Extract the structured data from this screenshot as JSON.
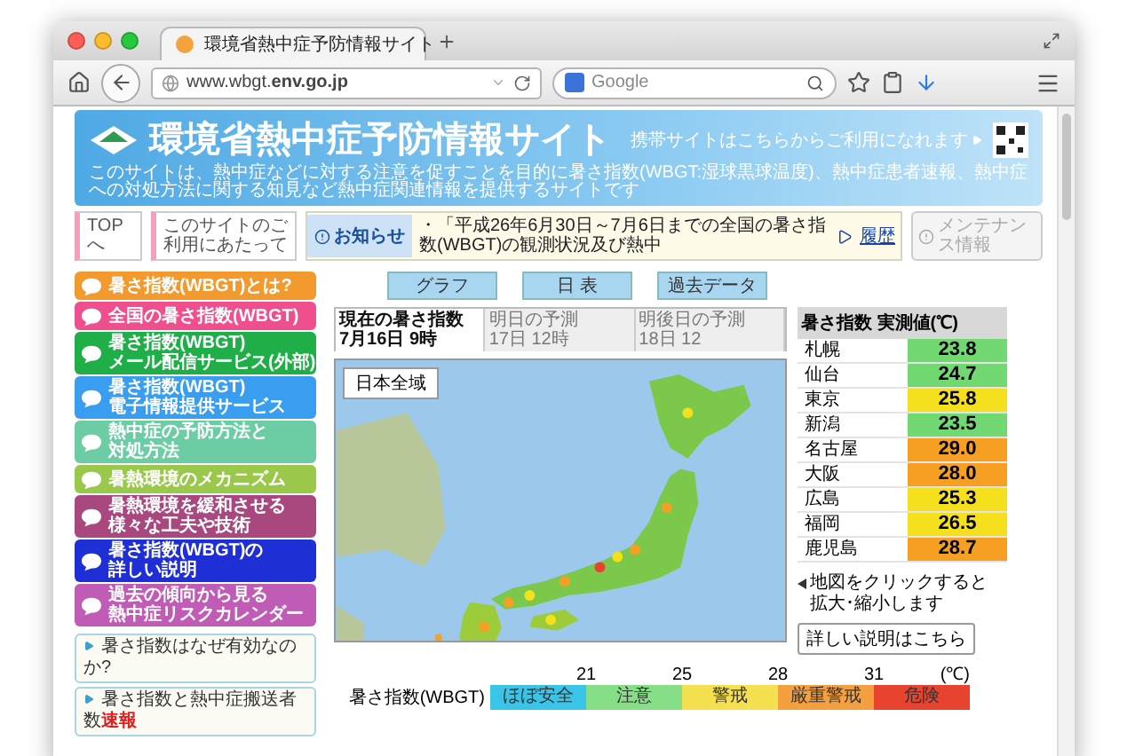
{
  "browser": {
    "tab_title": "環境省熱中症予防情報サイト",
    "url": "www.wbgt.**env.go.jp**",
    "search_placeholder": "Google"
  },
  "header": {
    "title": "環境省熱中症予防情報サイト",
    "mobile_note": "携帯サイトはこちらからご利用になれます",
    "tagline": "このサイトは、熱中症などに対する注意を促すことを目的に暑さ指数(WBGT:湿球黒球温度)、熱中症患者速報、熱中症への対処方法に関する知見など熱中症関連情報を提供するサイトです"
  },
  "nav": {
    "top": "TOPへ",
    "about": "このサイトのご利用にあたって",
    "notice_label": "お知らせ",
    "notice_text": "・「平成26年6月30日～7月6日までの全国の暑さ指数(WBGT)の観測状況及び熱中",
    "history": "履歴",
    "maintenance": {
      "label": "メンテナンス情報",
      "disabled": true
    }
  },
  "sidebar": {
    "items": [
      {
        "lines": [
          "暑さ指数(WBGT)とは?"
        ],
        "color": "#f39a2e"
      },
      {
        "lines": [
          "全国の暑さ指数(WBGT)"
        ],
        "color": "#ef4f8c"
      },
      {
        "lines": [
          "暑さ指数(WBGT)",
          "メール配信サービス(外部)"
        ],
        "color": "#1fae48"
      },
      {
        "lines": [
          "暑さ指数(WBGT)",
          "電子情報提供サービス"
        ],
        "color": "#3a9ef0"
      },
      {
        "lines": [
          "熱中症の予防方法と",
          "対処方法"
        ],
        "color": "#6ccca4"
      },
      {
        "lines": [
          "暑熱環境のメカニズム"
        ],
        "color": "#9ac84a"
      },
      {
        "lines": [
          "暑熱環境を緩和させる",
          "様々な工夫や技術"
        ],
        "color": "#a8487e"
      },
      {
        "lines": [
          "暑さ指数(WBGT)の",
          "詳しい説明"
        ],
        "color": "#1f2fd6"
      },
      {
        "lines": [
          "過去の傾向から見る",
          "熱中症リスクカレンダー"
        ],
        "color": "#c05cb6"
      }
    ],
    "links": [
      {
        "text": "暑さ指数はなぜ有効なのか?"
      },
      {
        "text": "暑さ指数と熱中症搬送者数",
        "badge": "速報"
      }
    ]
  },
  "views": [
    "グラフ",
    "日 表",
    "過去データ"
  ],
  "map": {
    "tabs": [
      {
        "label": "現在の暑さ指数",
        "time": "7月16日 9時",
        "selected": true
      },
      {
        "label": "明日の予測",
        "time": "17日 12時",
        "selected": false
      },
      {
        "label": "明後日の予測",
        "time": "18日 12",
        "selected": false
      }
    ],
    "region": "日本全域"
  },
  "readings": {
    "title": "暑さ指数 実測値(℃)",
    "rows": [
      {
        "city": "札幌",
        "value": "23.8",
        "color": "#72d872"
      },
      {
        "city": "仙台",
        "value": "24.7",
        "color": "#72d872"
      },
      {
        "city": "東京",
        "value": "25.8",
        "color": "#f5e01e"
      },
      {
        "city": "新潟",
        "value": "23.5",
        "color": "#72d872"
      },
      {
        "city": "名古屋",
        "value": "29.0",
        "color": "#f5a023"
      },
      {
        "city": "大阪",
        "value": "28.0",
        "color": "#f5a023"
      },
      {
        "city": "広島",
        "value": "25.3",
        "color": "#f5e01e"
      },
      {
        "city": "福岡",
        "value": "26.5",
        "color": "#f5e01e"
      },
      {
        "city": "鹿児島",
        "value": "28.7",
        "color": "#f5a023"
      }
    ]
  },
  "map_note": [
    "地図をクリックすると",
    "拡大･縮小します"
  ],
  "detail_button": "詳しい説明はこちら",
  "legend": {
    "label": "暑さ指数(WBGT)",
    "ticks": [
      "21",
      "25",
      "28",
      "31",
      "(℃)"
    ],
    "levels": [
      {
        "label": "ほぼ安全",
        "color": "#39c5e8"
      },
      {
        "label": "注意",
        "color": "#86de86"
      },
      {
        "label": "警戒",
        "color": "#f5e050"
      },
      {
        "label": "厳重警戒",
        "color": "#f5a040"
      },
      {
        "label": "危険",
        "color": "#e8432f"
      }
    ]
  }
}
